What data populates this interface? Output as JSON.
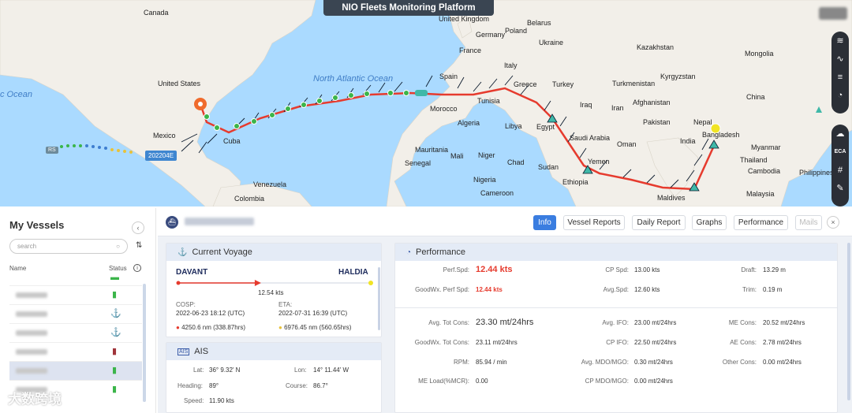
{
  "map": {
    "title": "NIO Fleets Monitoring Platform",
    "labels": {
      "canada": "Canada",
      "united_kingdom": "United Kingdom",
      "belarus": "Belarus",
      "poland": "Poland",
      "germany": "Germany",
      "ukraine": "Ukraine",
      "france": "France",
      "spain": "Spain",
      "italy": "Italy",
      "greece": "Greece",
      "turkey": "Turkey",
      "kazakhstan": "Kazakhstan",
      "mongolia": "Mongolia",
      "kyrgyzstan": "Kyrgyzstan",
      "turkmenistan": "Turkmenistan",
      "afghanistan": "Afghanistan",
      "china": "China",
      "iran": "Iran",
      "iraq": "Iraq",
      "pakistan": "Pakistan",
      "nepal": "Nepal",
      "bangladesh": "Bangladesh",
      "india": "India",
      "myanmar": "Myanmar",
      "thailand": "Thailand",
      "cambodia": "Cambodia",
      "philippines": "Philippines",
      "malaysia": "Malaysia",
      "maldives": "Maldives",
      "united_states": "United States",
      "mexico": "Mexico",
      "cuba": "Cuba",
      "venezuela": "Venezuela",
      "colombia": "Colombia",
      "morocco": "Morocco",
      "tunisia": "Tunisia",
      "algeria": "Algeria",
      "libya": "Libya",
      "egypt": "Egypt",
      "saudi_arabia": "Saudi Arabia",
      "oman": "Oman",
      "yemen": "Yemen",
      "mauritania": "Mauritania",
      "mali": "Mali",
      "niger": "Niger",
      "chad": "Chad",
      "sudan": "Sudan",
      "senegal": "Senegal",
      "nigeria": "Nigeria",
      "cameroon": "Cameroon",
      "ethiopia": "Ethiopia",
      "north_atlantic": "North Atlantic Ocean",
      "west_ocean": "c Ocean"
    },
    "vessel_tag": "202204E",
    "vessel_tag2": "RS",
    "toolbar_eca": "ECA",
    "route_color": "#e63b2e",
    "dot_color": "#3bb54a"
  },
  "left": {
    "title": "My Vessels",
    "search_placeholder": "search",
    "col_name": "Name",
    "col_status": "Status",
    "watermark": "大数跨境",
    "rows": [
      {
        "status_icon": "battery-icon",
        "color": "#3bb54a"
      },
      {
        "status_icon": "anchor-icon",
        "color": "#3bb54a"
      },
      {
        "status_icon": "anchor-icon",
        "color": "#3bb54a"
      },
      {
        "status_icon": "battery-icon",
        "color": "#a0343a"
      },
      {
        "status_icon": "battery-icon",
        "color": "#3bb54a"
      },
      {
        "status_icon": "battery-icon",
        "color": "#3bb54a"
      }
    ]
  },
  "tabs": {
    "info": "Info",
    "vessel_reports": "Vessel Reports",
    "daily_report": "Daily Report",
    "graphs": "Graphs",
    "performance": "Performance",
    "mails": "Mails"
  },
  "voyage": {
    "title": "Current Voyage",
    "from": "DAVANT",
    "to": "HALDIA",
    "speed": "12.54 kts",
    "progress": 0.43,
    "cosp_label": "COSP:",
    "cosp_value": "2022-06-23 18:12 (UTC)",
    "eta_label": "ETA:",
    "eta_value": "2022-07-31 16:39 (UTC)",
    "sailed": "4250.6 nm  (338.87hrs)",
    "remaining": "6976.45 nm  (560.65hrs)"
  },
  "ais": {
    "title": "AIS",
    "lat_label": "Lat:",
    "lat": "36° 9.32' N",
    "lon_label": "Lon:",
    "lon": "14° 11.44' W",
    "heading_label": "Heading:",
    "heading": "89°",
    "course_label": "Course:",
    "course": "86.7°",
    "speed_label": "Speed:",
    "speed": "11.90 kts"
  },
  "performance": {
    "title": "Performance",
    "perf_spd_label": "Perf.Spd:",
    "perf_spd": "12.44 kts",
    "cp_spd_label": "CP Spd:",
    "cp_spd": "13.00 kts",
    "draft_label": "Draft:",
    "draft": "13.29 m",
    "goodwx_perf_label": "GoodWx. Perf Spd:",
    "goodwx_perf": "12.44 kts",
    "avg_spd_label": "Avg.Spd:",
    "avg_spd": "12.60 kts",
    "trim_label": "Trim:",
    "trim": "0.19 m",
    "avg_tot_label": "Avg. Tot Cons:",
    "avg_tot": "23.30 mt/24hrs",
    "avg_ifo_label": "Avg. IFO:",
    "avg_ifo": "23.00 mt/24hrs",
    "me_cons_label": "ME Cons:",
    "me_cons": "20.52 mt/24hrs",
    "goodwx_tot_label": "GoodWx. Tot Cons:",
    "goodwx_tot": "23.11 mt/24hrs",
    "cp_ifo_label": "CP IFO:",
    "cp_ifo": "22.50 mt/24hrs",
    "ae_cons_label": "AE Cons:",
    "ae_cons": "2.78 mt/24hrs",
    "rpm_label": "RPM:",
    "rpm": "85.94 / min",
    "avg_mdo_label": "Avg. MDO/MGO:",
    "avg_mdo": "0.30 mt/24hrs",
    "other_cons_label": "Other Cons:",
    "other_cons": "0.00 mt/24hrs",
    "me_load_label": "ME Load(%MCR):",
    "me_load": "0.00",
    "cp_mdo_label": "CP MDO/MGO:",
    "cp_mdo": "0.00 mt/24hrs"
  }
}
